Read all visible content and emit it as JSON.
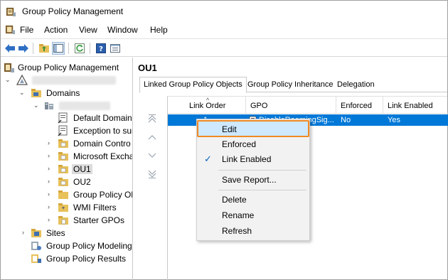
{
  "window": {
    "title": "Group Policy Management"
  },
  "menu": [
    "File",
    "Action",
    "View",
    "Window",
    "Help"
  ],
  "tree": {
    "root": "Group Policy Management",
    "domains": "Domains",
    "default_domain": "Default Domain",
    "exception": "Exception to sur",
    "domain_controllers": "Domain Contro",
    "microsoft_exchange": "Microsoft Excha",
    "ou1": "OU1",
    "ou2": "OU2",
    "group_policy_objects": "Group Policy Ol",
    "wmi_filters": "WMI Filters",
    "starter_gpos": "Starter GPOs",
    "sites": "Sites",
    "modeling": "Group Policy Modeling",
    "results": "Group Policy Results"
  },
  "content": {
    "heading": "OU1",
    "tabs": [
      "Linked Group Policy Objects",
      "Group Policy Inheritance",
      "Delegation"
    ],
    "columns": [
      "Link Order",
      "GPO",
      "Enforced",
      "Link Enabled"
    ],
    "row": {
      "link_order": "1",
      "gpo": "DisableRoamingSig...",
      "enforced": "No",
      "link_enabled": "Yes"
    }
  },
  "context_menu": [
    "Edit",
    "Enforced",
    "Link Enabled",
    "Save Report...",
    "Delete",
    "Rename",
    "Refresh"
  ],
  "colors": {
    "selection": "#0078d7",
    "menu_highlight": "#cde8ff",
    "callout": "#f08a24"
  }
}
